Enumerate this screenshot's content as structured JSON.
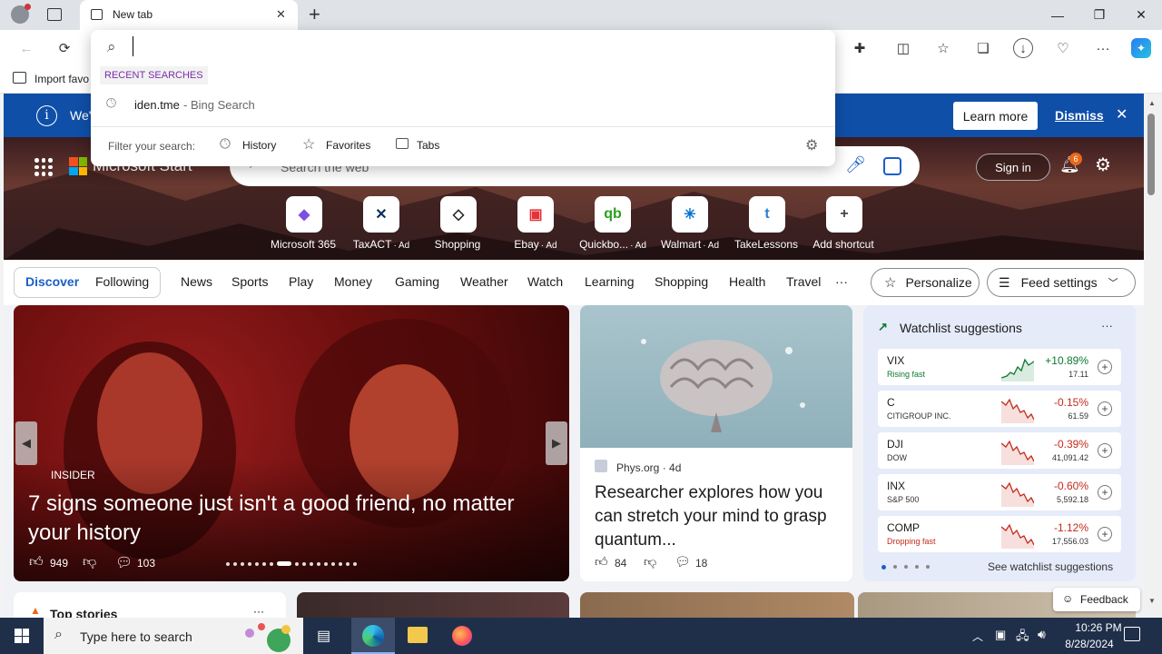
{
  "browser": {
    "tab_title": "New tab",
    "close_tab": "✕",
    "new_tab": "+",
    "window_min": "—",
    "window_max": "❐",
    "window_close": "✕"
  },
  "favorites_bar": {
    "import_label": "Import favo"
  },
  "omnibox": {
    "input_value": "",
    "recent_heading": "RECENT SEARCHES",
    "recent_item_query": "iden.tme",
    "recent_item_source": " - Bing Search",
    "filter_label": "Filter your search:",
    "filters": [
      "History",
      "Favorites",
      "Tabs"
    ]
  },
  "infobar": {
    "text": "We'",
    "learn_more": "Learn more",
    "dismiss": "Dismiss"
  },
  "header": {
    "brand": "Microsoft Start",
    "search_placeholder": "Search the web",
    "sign_in": "Sign in",
    "notification_count": "6"
  },
  "shortcuts": [
    {
      "label": "Microsoft 365",
      "ad": "",
      "glyph": "◆",
      "color": "#7b4fe0"
    },
    {
      "label": "TaxACT",
      "ad": "· Ad",
      "glyph": "✕",
      "color": "#0b2e5a"
    },
    {
      "label": "Shopping",
      "ad": "",
      "glyph": "◇",
      "color": "#222222"
    },
    {
      "label": "Ebay",
      "ad": "· Ad",
      "glyph": "▣",
      "color": "#e53238"
    },
    {
      "label": "Quickbo...",
      "ad": "· Ad",
      "glyph": "qb",
      "color": "#2ca01c"
    },
    {
      "label": "Walmart",
      "ad": "· Ad",
      "glyph": "✳",
      "color": "#0071ce"
    },
    {
      "label": "TakeLessons",
      "ad": "",
      "glyph": "t",
      "color": "#2a7fd4"
    },
    {
      "label": "Add shortcut",
      "ad": "",
      "glyph": "+",
      "color": "#444444"
    }
  ],
  "nav": {
    "discover": "Discover",
    "following": "Following",
    "links": [
      "News",
      "Sports",
      "Play",
      "Money",
      "Gaming",
      "Weather",
      "Watch",
      "Learning",
      "Shopping",
      "Health",
      "Travel"
    ],
    "more": "···",
    "personalize": "Personalize",
    "feed_settings": "Feed settings"
  },
  "main_card": {
    "source": "INSIDER",
    "headline": "7 signs someone just isn't a good friend, no matter your history",
    "likes": "949",
    "comments": "103"
  },
  "brain_card": {
    "source": "Phys.org · 4d",
    "headline": "Researcher explores how you can stretch your mind to grasp quantum...",
    "likes": "84",
    "comments": "18"
  },
  "watchlist": {
    "title": "Watchlist suggestions",
    "see_more": "See watchlist suggestions",
    "stocks": [
      {
        "symbol": "VIX",
        "sub": "Rising fast",
        "pct": "+10.89%",
        "price": "17.11",
        "color": "#0a7a2f",
        "sub_color": "#0a7a2f"
      },
      {
        "symbol": "C",
        "sub": "CITIGROUP INC.",
        "pct": "-0.15%",
        "price": "61.59",
        "color": "#c42b1c",
        "sub_color": "#333333"
      },
      {
        "symbol": "DJI",
        "sub": "DOW",
        "pct": "-0.39%",
        "price": "41,091.42",
        "color": "#c42b1c",
        "sub_color": "#333333"
      },
      {
        "symbol": "INX",
        "sub": "S&P 500",
        "pct": "-0.60%",
        "price": "5,592.18",
        "color": "#c42b1c",
        "sub_color": "#333333"
      },
      {
        "symbol": "COMP",
        "sub": "Dropping fast",
        "pct": "-1.12%",
        "price": "17,556.03",
        "color": "#c42b1c",
        "sub_color": "#c42b1c"
      }
    ]
  },
  "lower": {
    "top_stories": "Top stories",
    "feedback": "Feedback"
  },
  "taskbar": {
    "search_placeholder": "Type here to search",
    "time": "10:26 PM",
    "date": "8/28/2024"
  }
}
